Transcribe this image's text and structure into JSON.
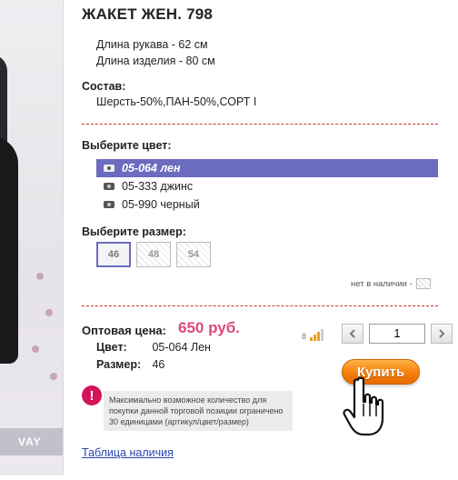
{
  "product": {
    "title": "ЖАКЕТ ЖЕН. 798",
    "sleeve_length": "Длина рукава - 62 см",
    "item_length": "Длина изделия - 80 см",
    "composition_label": "Состав:",
    "composition_value": "Шерсть-50%,ПАН-50%,СОРТ I"
  },
  "photo": {
    "watermark": "VAY"
  },
  "color": {
    "label": "Выберите цвет:",
    "options": [
      "05-064 лен",
      "05-333 джинс",
      "05-990 черный"
    ],
    "selected_index": 0
  },
  "size": {
    "label": "Выберите размер:",
    "options": [
      "46",
      "48",
      "54"
    ],
    "selected": "46"
  },
  "availability_note": "нет в наличии -",
  "price": {
    "label": "Оптовая цена:",
    "value": "650 руб.",
    "color_key": "Цвет:",
    "color_val": "05-064 Лен",
    "size_key": "Размер:",
    "size_val": "46"
  },
  "stock": {
    "count": "8",
    "level_bars_on": 3,
    "level_bars_total": 4
  },
  "quantity": {
    "value": "1",
    "prev_icon": "chevron-left-icon",
    "next_icon": "chevron-right-icon"
  },
  "buy_button": "Купить",
  "warning": {
    "icon": "!",
    "text": "Максимально возможное количество для покупки данной торговой позиции ограничено 30 единицами (артикул/цвет/размер)"
  },
  "availability_link": "Таблица наличия",
  "colors": {
    "accent": "#6b6bbf",
    "price": "#e04778",
    "divider": "#cc3333",
    "buy": "#f57f0a"
  }
}
